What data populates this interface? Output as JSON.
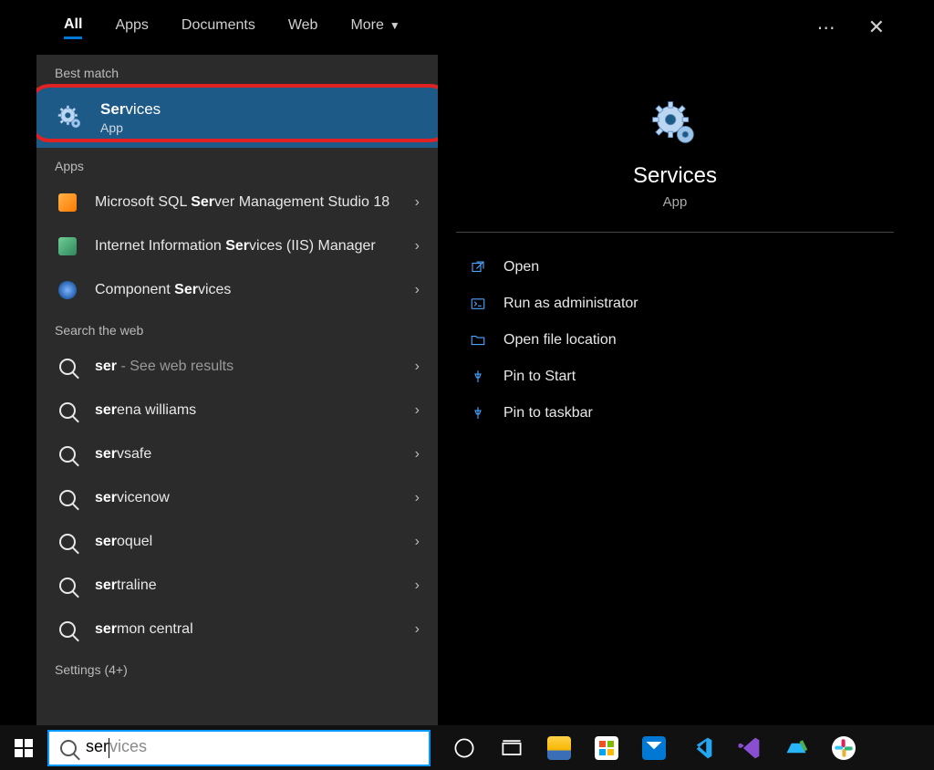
{
  "tabs": {
    "all": "All",
    "apps": "Apps",
    "docs": "Documents",
    "web": "Web",
    "more": "More"
  },
  "sections": {
    "best_match": "Best match",
    "apps": "Apps",
    "web": "Search the web",
    "settings": "Settings (4+)"
  },
  "best_match": {
    "title_prefix": "Ser",
    "title_rest": "vices",
    "subtitle": "App"
  },
  "app_results": [
    {
      "icon": "ssms",
      "pre": "Microsoft SQL ",
      "bold": "Ser",
      "post": "ver Management Studio 18"
    },
    {
      "icon": "iis",
      "pre": "Internet Information ",
      "bold": "Ser",
      "post": "vices (IIS) Manager"
    },
    {
      "icon": "comp",
      "pre": "Component ",
      "bold": "Ser",
      "post": "vices"
    }
  ],
  "web_results": [
    {
      "pre": "",
      "bold": "ser",
      "post": "",
      "hint": " - See web results"
    },
    {
      "pre": "",
      "bold": "ser",
      "post": "ena williams"
    },
    {
      "pre": "",
      "bold": "ser",
      "post": "vsafe"
    },
    {
      "pre": "",
      "bold": "ser",
      "post": "vicenow"
    },
    {
      "pre": "",
      "bold": "ser",
      "post": "oquel"
    },
    {
      "pre": "",
      "bold": "ser",
      "post": "traline"
    },
    {
      "pre": "",
      "bold": "ser",
      "post": "mon central"
    }
  ],
  "preview": {
    "title": "Services",
    "subtitle": "App"
  },
  "actions": [
    {
      "icon": "open",
      "label": "Open"
    },
    {
      "icon": "admin",
      "label": "Run as administrator"
    },
    {
      "icon": "folder",
      "label": "Open file location"
    },
    {
      "icon": "pin-start",
      "label": "Pin to Start"
    },
    {
      "icon": "pin-task",
      "label": "Pin to taskbar"
    }
  ],
  "search": {
    "typed": "ser",
    "ghost": "vices"
  }
}
